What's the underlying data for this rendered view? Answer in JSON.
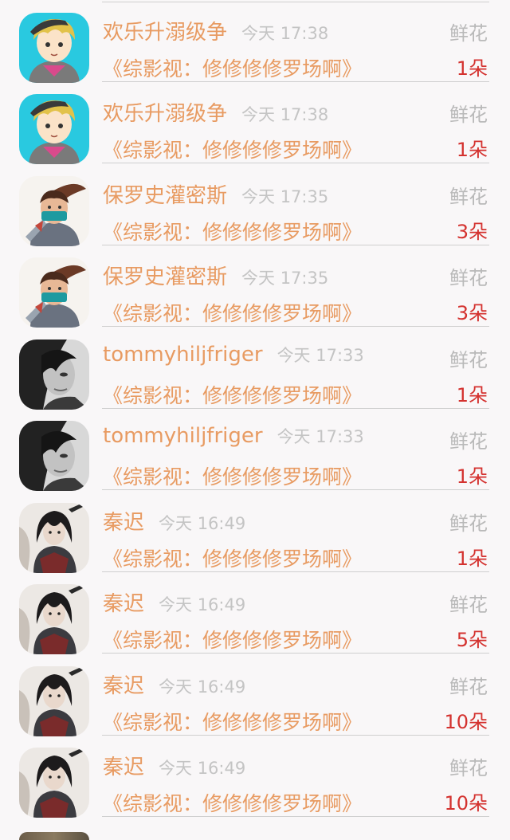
{
  "messages": [
    {
      "name": "欢乐升溺级争",
      "time": "今天 17:38",
      "gift": "鲜花",
      "book": "《综影视：修修修修罗场啊》",
      "count": "1朵",
      "avatar": "anime-boy"
    },
    {
      "name": "欢乐升溺级争",
      "time": "今天 17:38",
      "gift": "鲜花",
      "book": "《综影视：修修修修罗场啊》",
      "count": "1朵",
      "avatar": "anime-boy"
    },
    {
      "name": "保罗史灌密斯",
      "time": "今天 17:35",
      "gift": "鲜花",
      "book": "《综影视：修修修修罗场啊》",
      "count": "3朵",
      "avatar": "ninja"
    },
    {
      "name": "保罗史灌密斯",
      "time": "今天 17:35",
      "gift": "鲜花",
      "book": "《综影视：修修修修罗场啊》",
      "count": "3朵",
      "avatar": "ninja"
    },
    {
      "name": "tommyhiljfriger",
      "time": "今天 17:33",
      "gift": "鲜花",
      "book": "《综影视：修修修修罗场啊》",
      "count": "1朵",
      "avatar": "bw-portrait"
    },
    {
      "name": "tommyhiljfriger",
      "time": "今天 17:33",
      "gift": "鲜花",
      "book": "《综影视：修修修修罗场啊》",
      "count": "1朵",
      "avatar": "bw-portrait"
    },
    {
      "name": "秦迟",
      "time": "今天 16:49",
      "gift": "鲜花",
      "book": "《综影视：修修修修罗场啊》",
      "count": "1朵",
      "avatar": "ink-warrior"
    },
    {
      "name": "秦迟",
      "time": "今天 16:49",
      "gift": "鲜花",
      "book": "《综影视：修修修修罗场啊》",
      "count": "5朵",
      "avatar": "ink-warrior"
    },
    {
      "name": "秦迟",
      "time": "今天 16:49",
      "gift": "鲜花",
      "book": "《综影视：修修修修罗场啊》",
      "count": "10朵",
      "avatar": "ink-warrior"
    },
    {
      "name": "秦迟",
      "time": "今天 16:49",
      "gift": "鲜花",
      "book": "《综影视：修修修修罗场啊》",
      "count": "10朵",
      "avatar": "ink-warrior"
    }
  ],
  "colors": {
    "accent_orange": "#e89b62",
    "count_red": "#d4322f",
    "muted_gray": "#b9b9b9",
    "background": "#f9f7f8"
  }
}
